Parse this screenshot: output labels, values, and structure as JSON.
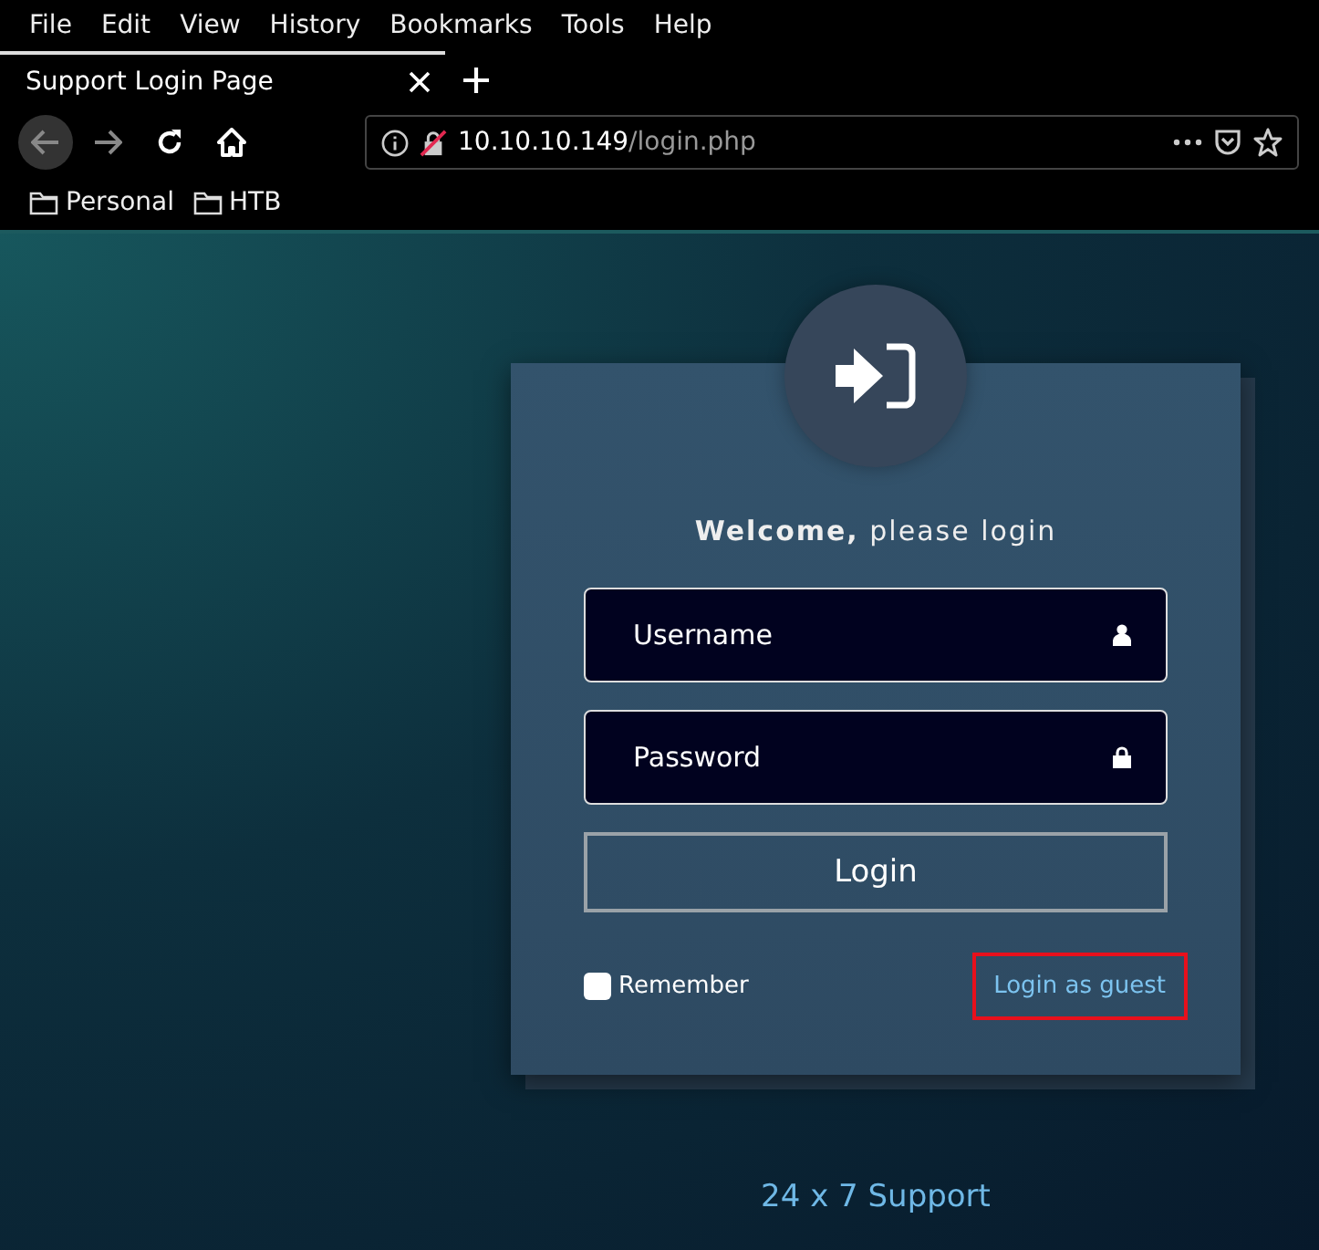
{
  "menu_bar": [
    "File",
    "Edit",
    "View",
    "History",
    "Bookmarks",
    "Tools",
    "Help"
  ],
  "tabs": [
    {
      "title": "Support Login Page",
      "selected": true
    }
  ],
  "address_bar": {
    "host": "10.10.10.149",
    "path": "/login.php"
  },
  "bookmarks": [
    "Personal",
    "HTB"
  ],
  "login": {
    "heading": "**Welcome,** please login",
    "username_placeholder": "Username",
    "password_placeholder": "Password",
    "button": "Login",
    "remember": {
      "label": "Remember",
      "checked": false
    },
    "guest_link": {
      "label": "Login as guest",
      "highlighted": true
    }
  },
  "footer": "24 x 7 Support"
}
